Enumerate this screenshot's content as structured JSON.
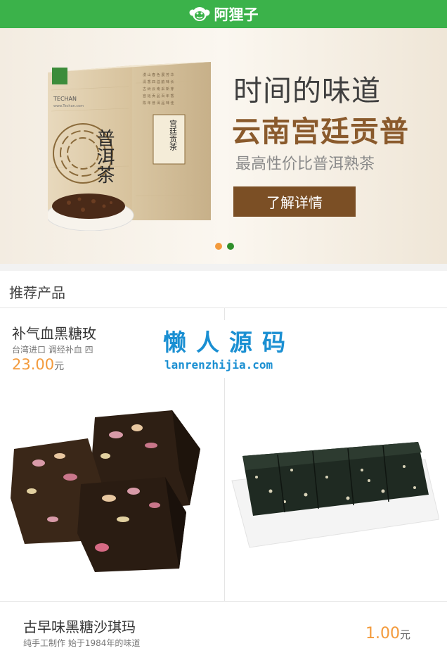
{
  "header": {
    "logo_text": "阿狸子",
    "logo_icon": "monkey-face-icon",
    "color": "#3bb24a"
  },
  "banner": {
    "title": "时间的味道",
    "subtitle": "云南宫廷贡普",
    "description": "最高性价比普洱熟茶",
    "button_label": "了解详情",
    "product_box_text": "普洱茶",
    "product_label": "宫廷贡茶",
    "brand": "TECHAN",
    "brand_url": "www.Techan.com",
    "carousel_active_color": "#f39a3b",
    "carousel_inactive_color": "#2f8f2a"
  },
  "section": {
    "title": "推荐产品"
  },
  "products": [
    {
      "name": "补气血黑糖玫",
      "desc": "台湾进口 调经补血 四",
      "price": "23.00",
      "unit": "元"
    },
    {
      "name": "",
      "desc": "",
      "price": "",
      "unit": ""
    }
  ],
  "watermark": {
    "title": "懒人源码",
    "url": "lanrenzhijia.com"
  },
  "bottom_item": {
    "name": "古早味黑糖沙琪玛",
    "desc": "纯手工制作 始于1984年的味道",
    "price": "1.00",
    "unit": "元"
  }
}
